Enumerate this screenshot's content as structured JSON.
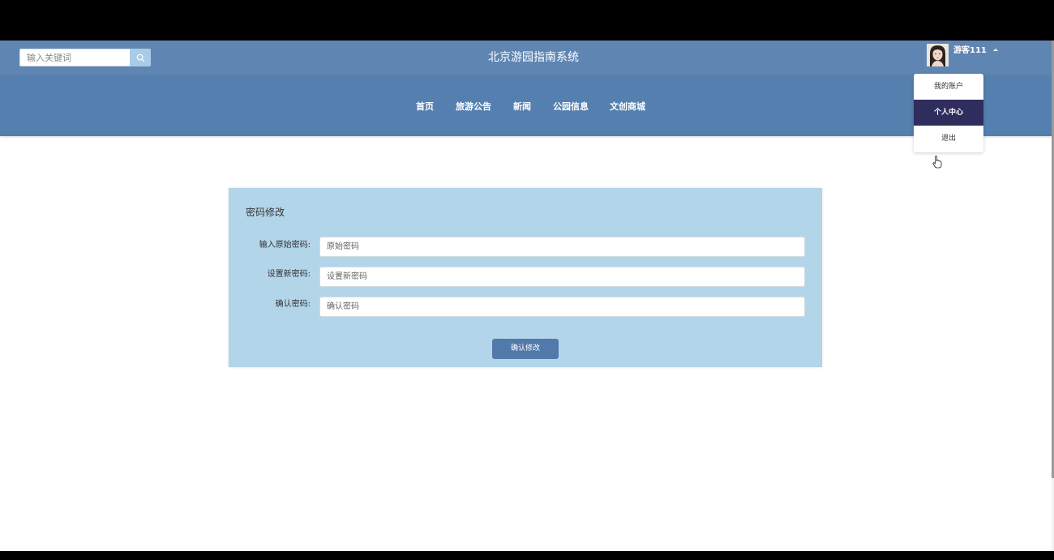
{
  "header": {
    "search": {
      "placeholder": "输入关键词"
    },
    "title": "北京游园指南系统",
    "user": {
      "name": "游客111"
    }
  },
  "nav": {
    "items": [
      {
        "label": "首页"
      },
      {
        "label": "旅游公告"
      },
      {
        "label": "新闻"
      },
      {
        "label": "公园信息"
      },
      {
        "label": "文创商城"
      }
    ]
  },
  "user_menu": {
    "items": [
      {
        "label": "我的账户"
      },
      {
        "label": "个人中心"
      },
      {
        "label": "退出"
      }
    ],
    "active": "个人中心"
  },
  "form": {
    "title": "密码修改",
    "fields": [
      {
        "label": "输入原始密码:",
        "placeholder": "原始密码",
        "value": ""
      },
      {
        "label": "设置新密码:",
        "placeholder": "设置新密码",
        "value": ""
      },
      {
        "label": "确认密码:",
        "placeholder": "确认密码",
        "value": ""
      }
    ],
    "submit_label": "确认修改"
  },
  "colors": {
    "header_bg": "#5f86b3",
    "nav_bg": "#547fae",
    "card_bg": "#b3d5ea",
    "button_bg": "#5179aa",
    "menu_active_bg": "#2f2d5e"
  }
}
